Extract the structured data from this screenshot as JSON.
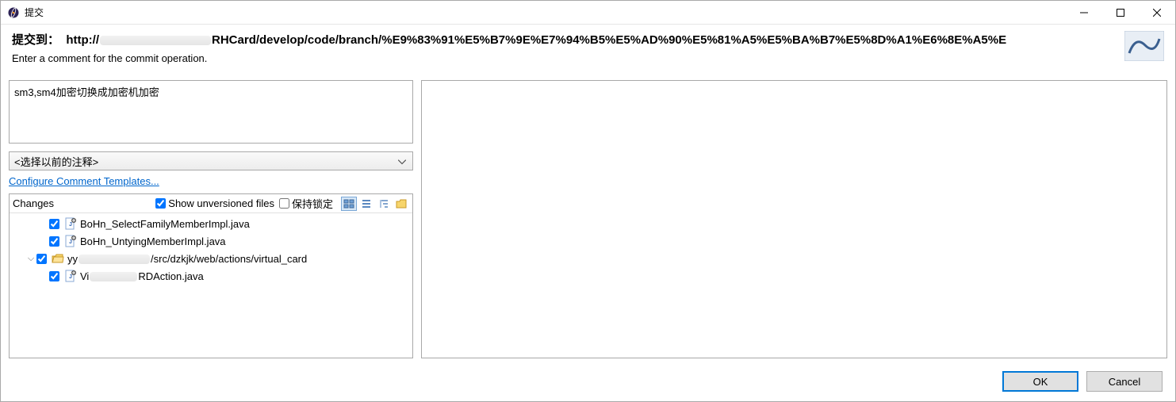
{
  "titlebar": {
    "title": "提交"
  },
  "banner": {
    "prefix": "提交到：",
    "url_left": "http://",
    "url_right": "RHCard/develop/code/branch/%E9%83%91%E5%B7%9E%E7%94%B5%E5%AD%90%E5%81%A5%E5%BA%B7%E5%8D%A1%E6%8E%A5%E",
    "sub": "Enter a comment for the commit operation."
  },
  "comment": {
    "value": "sm3,sm4加密切换成加密机加密"
  },
  "prev_comment_dd": {
    "label": "<选择以前的注释>"
  },
  "config_link": {
    "label": "Configure Comment Templates..."
  },
  "changes": {
    "label": "Changes",
    "show_unversioned": {
      "label": "Show unversioned files",
      "checked": true
    },
    "keep_locks": {
      "label": "保持锁定",
      "checked": false
    }
  },
  "tree": {
    "items": [
      {
        "name": "BoHn_SelectFamilyMemberImpl.java",
        "type": "file",
        "checked": true
      },
      {
        "name": "BoHn_UntyingMemberImpl.java",
        "type": "file",
        "checked": true
      },
      {
        "prefix": "yy",
        "suffix": "/src/dzkjk/web/actions/virtual_card",
        "type": "folder",
        "checked": true,
        "expanded": true
      },
      {
        "prefix": "Vi",
        "suffix": "RDAction.java",
        "type": "file",
        "checked": true,
        "indent": true
      }
    ]
  },
  "footer": {
    "ok": "OK",
    "cancel": "Cancel"
  }
}
